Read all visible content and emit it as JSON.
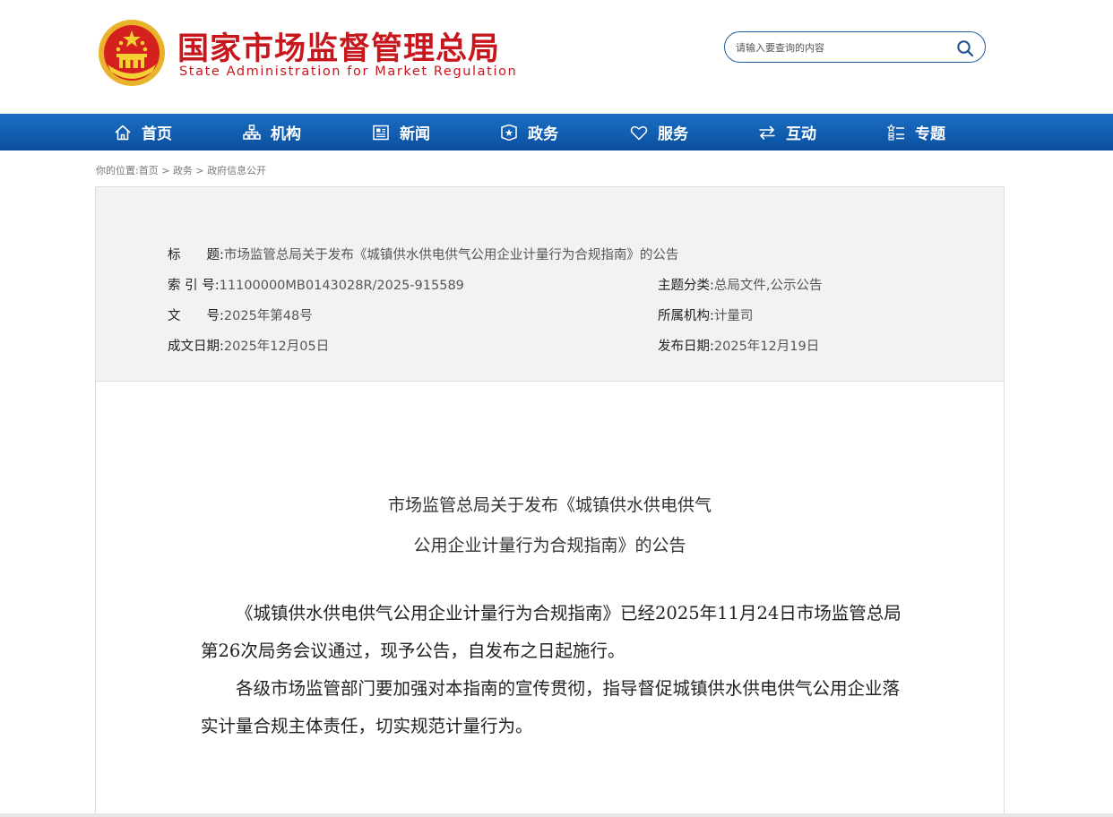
{
  "header": {
    "title_cn": "国家市场监督管理总局",
    "title_en": "State Administration for Market Regulation",
    "search_placeholder": "请输入要查询的内容"
  },
  "nav": [
    {
      "label": "首页",
      "icon": "home-icon"
    },
    {
      "label": "机构",
      "icon": "org-chart-icon"
    },
    {
      "label": "新闻",
      "icon": "news-icon"
    },
    {
      "label": "政务",
      "icon": "government-icon"
    },
    {
      "label": "服务",
      "icon": "heart-icon"
    },
    {
      "label": "互动",
      "icon": "exchange-icon"
    },
    {
      "label": "专题",
      "icon": "topics-icon"
    }
  ],
  "breadcrumb": {
    "prefix": "你的位置:",
    "items": [
      "首页",
      "政务",
      "政府信息公开"
    ],
    "separator": " > "
  },
  "info": {
    "title_label": "标　　题:",
    "title_value": "市场监管总局关于发布《城镇供水供电供气公用企业计量行为合规指南》的公告",
    "index_label": "索 引 号:",
    "index_value": "11100000MB0143028R/2025-915589",
    "category_label": "主题分类:",
    "category_value": "总局文件,公示公告",
    "docno_label": "文　　号:",
    "docno_value": "2025年第48号",
    "org_label": "所属机构:",
    "org_value": "计量司",
    "made_label": "成文日期:",
    "made_value": "2025年12月05日",
    "published_label": "发布日期:",
    "published_value": "2025年12月19日"
  },
  "article": {
    "title_line1": "市场监管总局关于发布《城镇供水供电供气",
    "title_line2": "公用企业计量行为合规指南》的公告",
    "paragraph1": "《城镇供水供电供气公用企业计量行为合规指南》已经2025年11月24日市场监管总局第26次局务会议通过，现予公告，自发布之日起施行。",
    "paragraph2": "各级市场监管部门要加强对本指南的宣传贯彻，指导督促城镇供水供电供气公用企业落实计量合规主体责任，切实规范计量行为。"
  },
  "colors": {
    "brand_red": "#c8161d",
    "nav_blue": "#0b4f9e"
  }
}
